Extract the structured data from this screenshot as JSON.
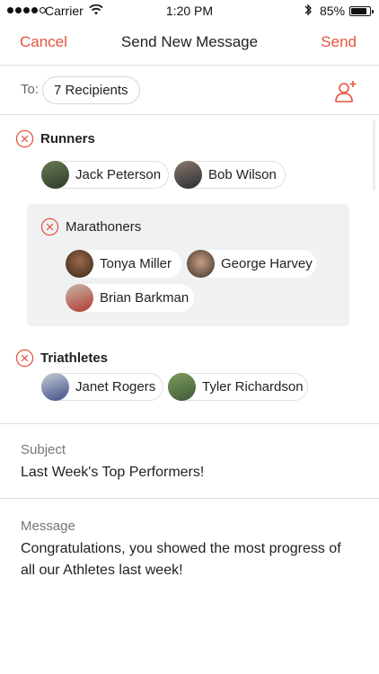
{
  "status_bar": {
    "carrier": "Carrier",
    "time": "1:20 PM",
    "battery": "85%",
    "battery_level": 0.85
  },
  "nav": {
    "cancel": "Cancel",
    "title": "Send New Message",
    "send": "Send"
  },
  "to": {
    "label": "To:",
    "recipients": "7 Recipients"
  },
  "groups": {
    "runners": {
      "name": "Runners",
      "members": [
        "Jack Peterson",
        "Bob Wilson"
      ]
    },
    "marathoners": {
      "name": "Marathoners",
      "members": [
        "Tonya Miller",
        "George Harvey",
        "Brian Barkman"
      ]
    },
    "triathletes": {
      "name": "Triathletes",
      "members": [
        "Janet Rogers",
        "Tyler Richardson"
      ]
    }
  },
  "subject": {
    "label": "Subject",
    "value": "Last Week's Top Performers!"
  },
  "message": {
    "label": "Message",
    "value": "Congratulations, you showed the most progress of all our Athletes last week!"
  },
  "colors": {
    "accent": "#e4533d",
    "subgroup_bg": "#f0f1f3"
  },
  "icons": [
    "wifi-icon",
    "bluetooth-icon",
    "battery-icon",
    "add-user-icon",
    "remove-group-icon"
  ]
}
